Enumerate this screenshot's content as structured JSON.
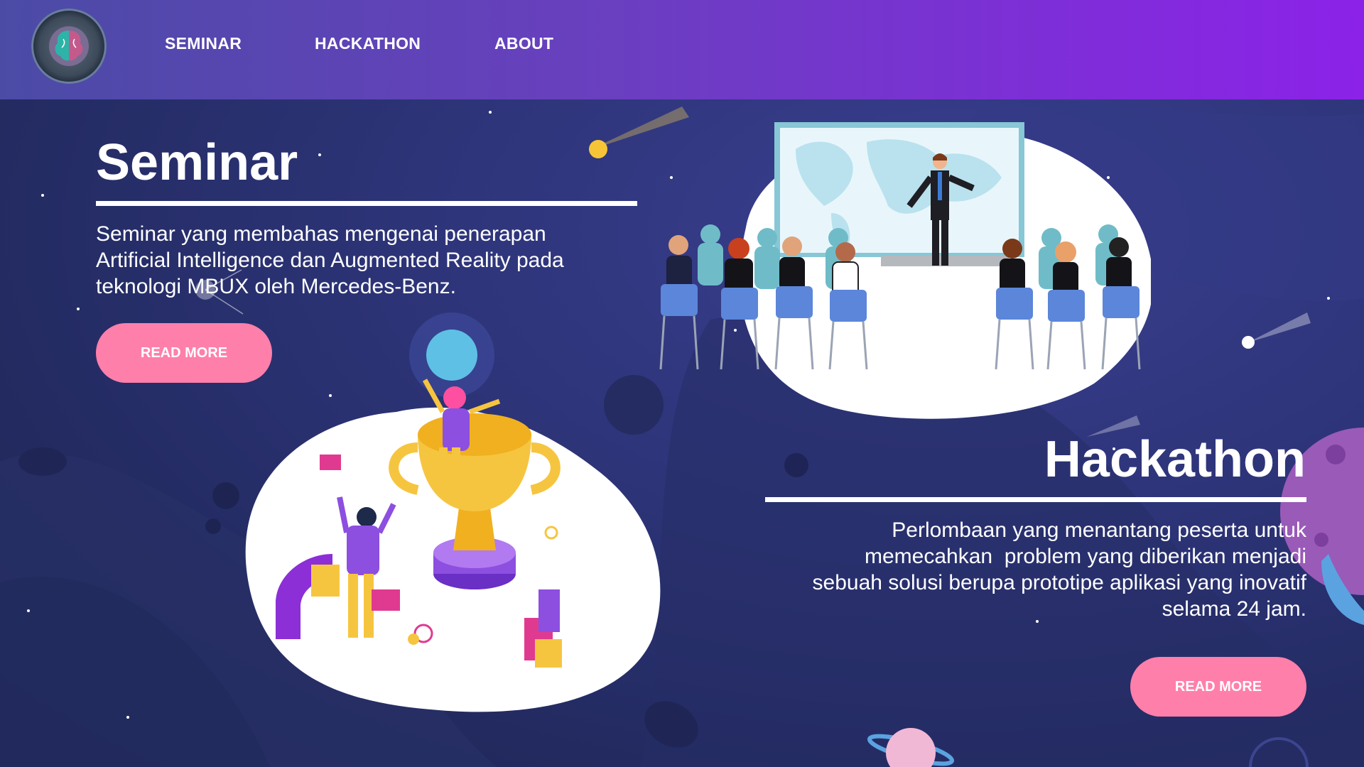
{
  "nav": {
    "links": [
      "SEMINAR",
      "HACKATHON",
      "ABOUT"
    ]
  },
  "seminar": {
    "title": "Seminar",
    "description_lines": [
      "Seminar yang membahas mengenai penerapan",
      "Artificial Intelligence dan Augmented Reality pada",
      "teknologi MBUX oleh Mercedes-Benz."
    ],
    "button_label": "READ MORE"
  },
  "hackathon": {
    "title": "Hackathon",
    "description_lines": [
      "Perlombaan yang menantang peserta untuk",
      "memecahkan  problem yang diberikan menjadi",
      "sebuah solusi berupa prototipe aplikasi yang inovatif",
      "selama 24 jam."
    ],
    "button_label": "READ MORE"
  },
  "colors": {
    "nav_start": "#4b4ba6",
    "nav_end": "#8c22e8",
    "button": "#ff7fab",
    "background": "#2d3478"
  }
}
